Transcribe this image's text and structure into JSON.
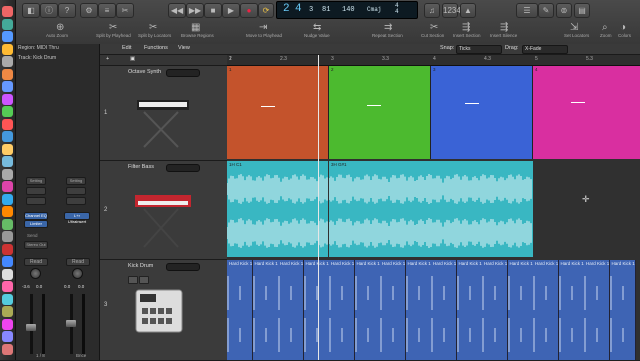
{
  "toolbar": {
    "labels": [
      "Auto Zoom",
      "Split by Playhead",
      "Split by Locators",
      "Browse Regions",
      "Move to Playhead",
      "Nudge Value",
      "Repeat Section",
      "Cut Section",
      "Insert Section",
      "Insert Silence",
      "Set Locators",
      "Zoom",
      "Colors"
    ],
    "lcd": {
      "bar": "2",
      "beat": "4",
      "div": "3",
      "tick": "81",
      "tempo": "140",
      "key": "Cmaj",
      "sig_top": "4",
      "sig_bottom": "4"
    }
  },
  "inspector": {
    "region": "Region: MIDI Thru",
    "track": "Track: Kick Drum",
    "setting_left": "Setting",
    "setting_right": "Setting",
    "eq_left": "",
    "eq_right": "",
    "channel_eq": "Channel EQ",
    "limiter": "Limiter",
    "ultra": "L+r Ultrainsert",
    "send": "Send",
    "stereo_out": "Stereo Out",
    "read_left": "Read",
    "read_right": "Read",
    "val_left": "-3.6",
    "val_right": "0.0",
    "val_left2": "0.0",
    "val_right2": "0.0",
    "bottom_left": "1 / 8",
    "bottom_right": "Bnce"
  },
  "menubar": {
    "edit": "Edit",
    "functions": "Functions",
    "view": "View",
    "snap_label": "Snap:",
    "snap_value": "Ticks",
    "drag_label": "Drag:",
    "drag_value": "X-Fade"
  },
  "ruler": [
    "1",
    "2",
    "2.3",
    "3",
    "3.3",
    "4",
    "4.3",
    "5",
    "5.3"
  ],
  "tracks": [
    {
      "num": "1",
      "name": "Octave Synth"
    },
    {
      "num": "2",
      "name": "Filter Bass"
    },
    {
      "num": "3",
      "name": "Kick Drum"
    }
  ],
  "regions": {
    "synth": [
      {
        "label": "1",
        "color": "#c4532c"
      },
      {
        "label": "2",
        "color": "#4cba2f"
      },
      {
        "label": "3",
        "color": "#3a63d6"
      },
      {
        "label": "4",
        "color": "#d92fa0"
      }
    ],
    "bass_labels": [
      "1H C1",
      "3H G#1"
    ],
    "kick_label": "Hard Kick 1"
  },
  "colors": {
    "accent": "#6bb8f0",
    "audio": "#39b7c2",
    "kick": "#3e64b4"
  }
}
